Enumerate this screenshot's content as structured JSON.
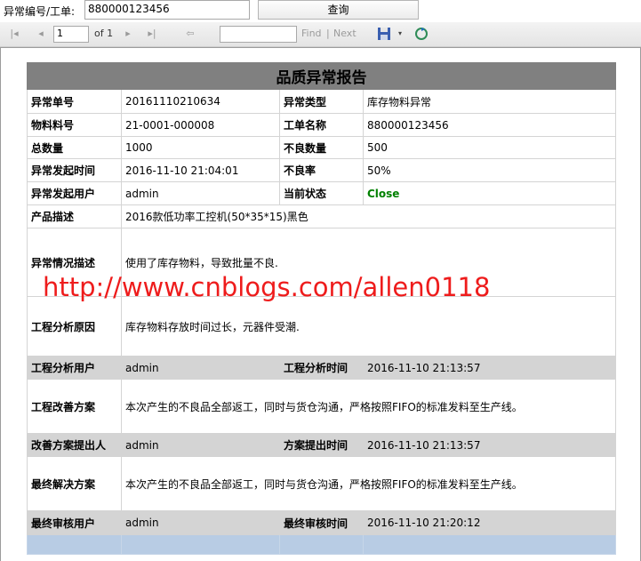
{
  "search": {
    "label": "异常编号/工单:",
    "value": "880000123456",
    "button": "查询"
  },
  "toolbar": {
    "first_icon": "first-page-icon",
    "prev_icon": "prev-page-icon",
    "page": "1",
    "of_label": "of 1",
    "next_icon": "next-page-icon",
    "last_icon": "last-page-icon",
    "back_icon": "back-icon",
    "find_label": "Find",
    "separator": "|",
    "next_label": "Next",
    "export_icon": "save-export-icon",
    "refresh_icon": "refresh-icon"
  },
  "report": {
    "title": "品质异常报告",
    "rows": {
      "r1": {
        "k1": "异常单号",
        "v1": "20161110210634",
        "k2": "异常类型",
        "v2": "库存物料异常"
      },
      "r2": {
        "k1": "物料料号",
        "v1": "21-0001-000008",
        "k2": "工单名称",
        "v2": "880000123456"
      },
      "r3": {
        "k1": "总数量",
        "v1": "1000",
        "k2": "不良数量",
        "v2": "500"
      },
      "r4": {
        "k1": "异常发起时间",
        "v1": "2016-11-10 21:04:01",
        "k2": "不良率",
        "v2": "50%"
      },
      "r5": {
        "k1": "异常发起用户",
        "v1": "admin",
        "k2": "当前状态",
        "v2": "Close"
      },
      "r6": {
        "k1": "产品描述",
        "v1": "2016款低功率工控机(50*35*15)黑色"
      },
      "r7": {
        "k1": "异常情况描述",
        "v1": "使用了库存物料，导致批量不良."
      },
      "r8": {
        "k1": "工程分析原因",
        "v1": "库存物料存放时间过长，元器件受潮."
      },
      "r9": {
        "k1": "工程分析用户",
        "v1": "admin",
        "k2": "工程分析时间",
        "v2": "2016-11-10 21:13:57"
      },
      "r10": {
        "k1": "工程改善方案",
        "v1": "本次产生的不良品全部返工，同时与货仓沟通，严格按照FIFO的标准发料至生产线。"
      },
      "r11": {
        "k1": "改善方案提出人",
        "v1": "admin",
        "k2": "方案提出时间",
        "v2": "2016-11-10 21:13:57"
      },
      "r12": {
        "k1": "最终解决方案",
        "v1": "本次产生的不良品全部返工，同时与货仓沟通，严格按照FIFO的标准发料至生产线。"
      },
      "r13": {
        "k1": "最终审核用户",
        "v1": "admin",
        "k2": "最终审核时间",
        "v2": "2016-11-10 21:20:12"
      }
    }
  },
  "watermark": "http://www.cnblogs.com/allen0118",
  "colors": {
    "status_close": "#008000",
    "title_bar": "#808080",
    "gray_row": "#d4d4d4",
    "blue_row": "#b8cce4",
    "watermark": "#ee1c1c"
  }
}
